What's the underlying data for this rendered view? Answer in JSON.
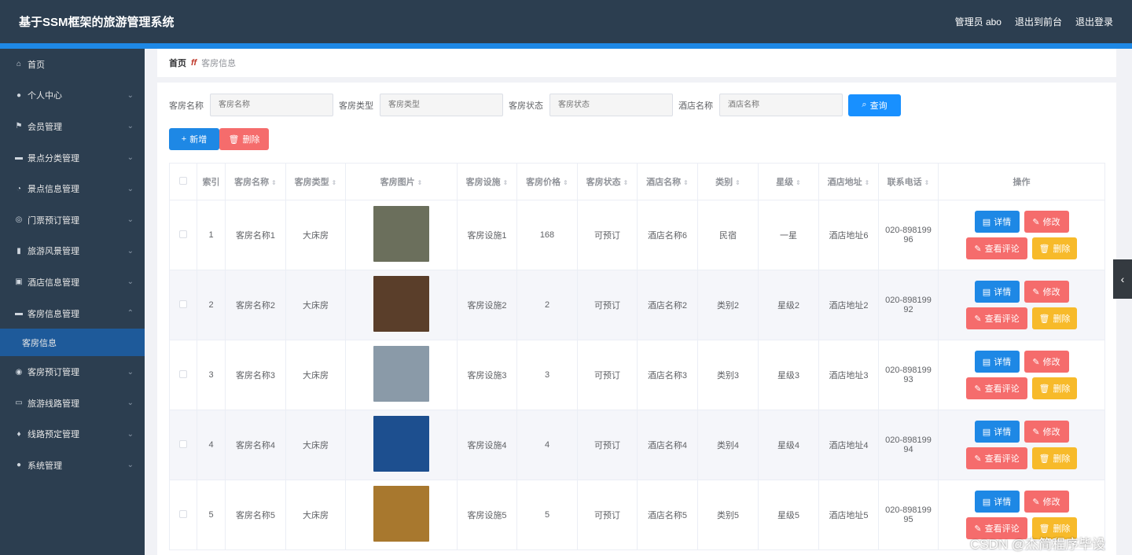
{
  "app": {
    "title": "基于SSM框架的旅游管理系统",
    "user_label": "管理员 abo",
    "back_front": "退出到前台",
    "logout": "退出登录"
  },
  "sidebar": {
    "items": [
      {
        "label": "首页",
        "icon": "home-icon"
      },
      {
        "label": "个人中心",
        "icon": "user-icon"
      },
      {
        "label": "会员管理",
        "icon": "flag-icon"
      },
      {
        "label": "景点分类管理",
        "icon": "camera-icon"
      },
      {
        "label": "景点信息管理",
        "icon": "bell-icon"
      },
      {
        "label": "门票预订管理",
        "icon": "target-icon"
      },
      {
        "label": "旅游风景管理",
        "icon": "bar-chart-icon"
      },
      {
        "label": "酒店信息管理",
        "icon": "clipboard-icon"
      },
      {
        "label": "客房信息管理",
        "icon": "camera-icon"
      },
      {
        "label": "客房预订管理",
        "icon": "help-icon"
      },
      {
        "label": "旅游线路管理",
        "icon": "message-icon"
      },
      {
        "label": "线路预定管理",
        "icon": "mic-icon"
      },
      {
        "label": "系统管理",
        "icon": "location-icon"
      }
    ],
    "active_sub": "客房信息"
  },
  "breadcrumb": {
    "home": "首页",
    "separator": "ff",
    "current": "客房信息"
  },
  "search": {
    "fields": [
      {
        "label": "客房名称",
        "placeholder": "客房名称"
      },
      {
        "label": "客房类型",
        "placeholder": "客房类型"
      },
      {
        "label": "客房状态",
        "placeholder": "客房状态"
      },
      {
        "label": "酒店名称",
        "placeholder": "酒店名称"
      }
    ],
    "query_label": "查询"
  },
  "actions": {
    "add_label": "新增",
    "delete_label": "删除"
  },
  "table": {
    "columns": [
      "索引",
      "客房名称",
      "客房类型",
      "客房图片",
      "客房设施",
      "客房价格",
      "客房状态",
      "酒店名称",
      "类别",
      "星级",
      "酒店地址",
      "联系电话",
      "操作"
    ],
    "rows": [
      {
        "index": "1",
        "name": "客房名称1",
        "type": "大床房",
        "facility": "客房设施1",
        "price": "168",
        "status": "可预订",
        "hotel": "酒店名称6",
        "category": "民宿",
        "star": "一星",
        "address": "酒店地址6",
        "phone_1": "020-898199",
        "phone_2": "96",
        "img_color": "#6b6f5c"
      },
      {
        "index": "2",
        "name": "客房名称2",
        "type": "大床房",
        "facility": "客房设施2",
        "price": "2",
        "status": "可预订",
        "hotel": "酒店名称2",
        "category": "类别2",
        "star": "星级2",
        "address": "酒店地址2",
        "phone_1": "020-898199",
        "phone_2": "92",
        "img_color": "#5a3e2a"
      },
      {
        "index": "3",
        "name": "客房名称3",
        "type": "大床房",
        "facility": "客房设施3",
        "price": "3",
        "status": "可预订",
        "hotel": "酒店名称3",
        "category": "类别3",
        "star": "星级3",
        "address": "酒店地址3",
        "phone_1": "020-898199",
        "phone_2": "93",
        "img_color": "#8a9aa8"
      },
      {
        "index": "4",
        "name": "客房名称4",
        "type": "大床房",
        "facility": "客房设施4",
        "price": "4",
        "status": "可预订",
        "hotel": "酒店名称4",
        "category": "类别4",
        "star": "星级4",
        "address": "酒店地址4",
        "phone_1": "020-898199",
        "phone_2": "94",
        "img_color": "#1d4f8f"
      },
      {
        "index": "5",
        "name": "客房名称5",
        "type": "大床房",
        "facility": "客房设施5",
        "price": "5",
        "status": "可预订",
        "hotel": "酒店名称5",
        "category": "类别5",
        "star": "星级5",
        "address": "酒店地址5",
        "phone_1": "020-898199",
        "phone_2": "95",
        "img_color": "#a8782e"
      }
    ],
    "row_buttons": {
      "detail": "详情",
      "edit": "修改",
      "review": "查看评论",
      "remove": "删除"
    }
  },
  "watermark": "CSDN @杰简程序毕设"
}
